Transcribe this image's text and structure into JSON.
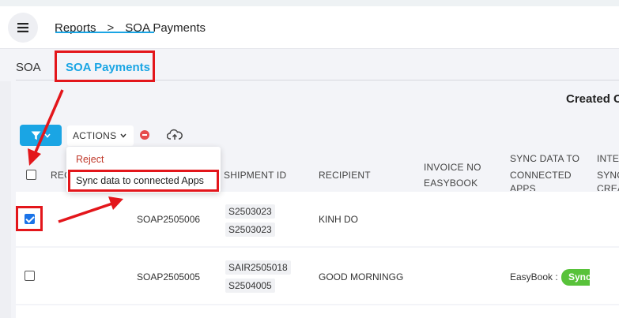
{
  "header": {
    "menu_icon": "hamburger-icon",
    "breadcrumb": [
      "Reports",
      "SOA Payments"
    ],
    "breadcrumb_separator": ">"
  },
  "tabs": [
    {
      "label": "SOA",
      "active": false
    },
    {
      "label": "SOA Payments",
      "active": true
    }
  ],
  "toolbar": {
    "created_label": "Created C",
    "filter_icon": "filter-icon",
    "actions_label": "ACTIONS",
    "remove_icon": "minus-circle-icon",
    "upload_icon": "cloud-upload-icon"
  },
  "actions_menu": {
    "items": [
      "Reject",
      "Sync data to connected Apps"
    ]
  },
  "table": {
    "columns": [
      "REC",
      "SHIPMENT ID",
      "RECIPIENT",
      "INVOICE NO",
      "EASYBOOK",
      "SYNC DATA TO",
      "CONNECTED",
      "APPS",
      "INTE",
      "SYNC",
      "CREA"
    ],
    "rows": [
      {
        "checked": true,
        "soa_id": "SOAP2505006",
        "shipments": [
          "S2503023",
          "S2503023"
        ],
        "recipient": "KINH DO",
        "sync": "",
        "sync_badge": ""
      },
      {
        "checked": false,
        "soa_id": "SOAP2505005",
        "shipments": [
          "SAIR2505018",
          "S2504005"
        ],
        "recipient": "GOOD MORNINGG",
        "sync": "EasyBook :",
        "sync_badge": "Sync"
      }
    ]
  },
  "colors": {
    "accent": "#1aa5e4",
    "annotation": "#e3161b",
    "checkbox_checked": "#1a73e8",
    "sync_badge": "#58c23a",
    "reject_text": "#c0392b"
  }
}
